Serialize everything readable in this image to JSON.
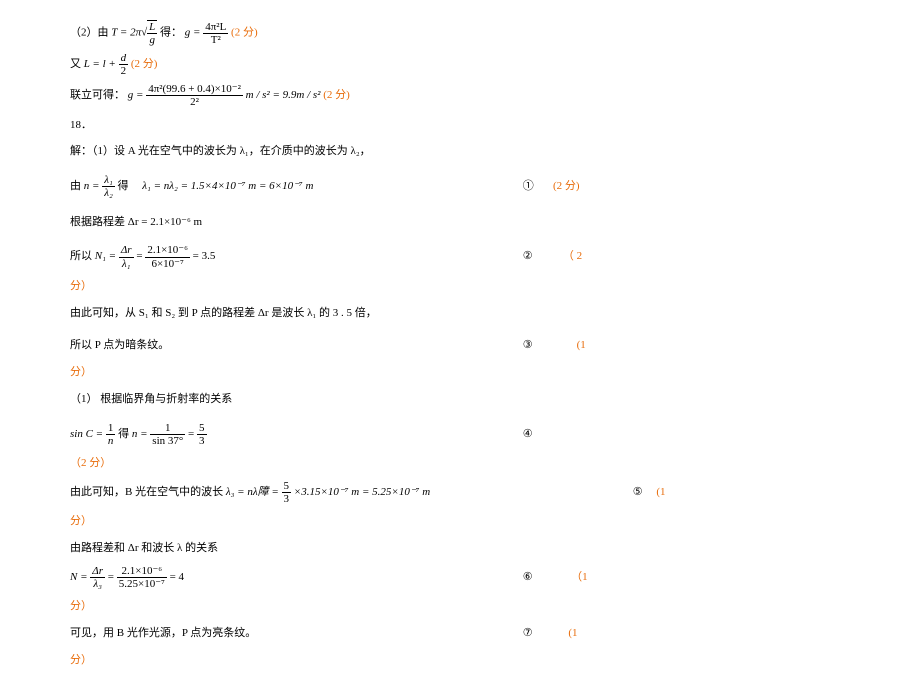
{
  "q2": {
    "intro": "（2）由",
    "eqT": "T = 2π",
    "sqrt_L": "L",
    "sqrt_g": "g",
    "deriv": "得：",
    "g_eq": "g =",
    "g_num": "4π²L",
    "g_den": "T²",
    "score1": "(2 分)",
    "also": "又",
    "L_eq": "L = l +",
    "d_num": "d",
    "d_den": "2",
    "score2": "(2 分)",
    "joint": "联立可得：",
    "g2_eq": "g =",
    "g2_num": "4π²(99.6 + 0.4)×10⁻²",
    "g2_den": "2²",
    "g2_unit1": "m / s² = 9.9m / s²",
    "score3": "(2 分)"
  },
  "q18": {
    "num": "18．",
    "sol": "解：（1）设 A 光在空气中的波长为 λ₁，在介质中的波长为 λ₂，",
    "by_n1": "由",
    "n_eq": "n =",
    "n_num": "λ₁",
    "n_den": "λ₂",
    "deriv": "得",
    "lam1": "λ₁ = nλ₂ = 1.5×4×10⁻⁷ m = 6×10⁻⁷ m",
    "circ1": "①",
    "score1": "(2 分)",
    "path": "根据路程差 Δr = 2.1×10⁻⁶ m",
    "so_N1": "所以",
    "N1_eq": "N₁ =",
    "N1_num1": "Δr",
    "N1_den1": "λ₁",
    "eq2": "=",
    "N1_num2": "2.1×10⁻⁶",
    "N1_den2": "6×10⁻⁷",
    "N1_res": "= 3.5",
    "circ2": "②",
    "score2": "（ 2",
    "fen1": "分）",
    "from_s": "由此可知，从 S₁ 和 S₂ 到 P 点的路程差 Δr 是波长 λ₁ 的 3 . 5 倍，",
    "dark": "所以 P 点为暗条纹。",
    "circ3": "③",
    "score3": "(1",
    "fen2": "分）",
    "part2": "（1） 根据临界角与折射率的关系",
    "sinC": "sin C =",
    "sinC_num": "1",
    "sinC_den": "n",
    "deriv2": "得",
    "n2": "n =",
    "n2_num": "1",
    "n2_den": "sin 37°",
    "eq3": "=",
    "frac53_num": "5",
    "frac53_den": "3",
    "circ4": "④",
    "score4": "（2 分）",
    "from_b": "由此可知，B 光在空气中的波长",
    "lam3": "λ₃ = nλ障 =",
    "lam3_num": "5",
    "lam3_den": "3",
    "lam3_tail": "×3.15×10⁻⁷ m = 5.25×10⁻⁷ m",
    "circ5": "⑤",
    "score5": "(1",
    "fen3": "分）",
    "bypath": "由路程差和 Δr 和波长 λ 的关系",
    "N_eq": "N =",
    "N_num1": "Δr",
    "N_den1": "λ₃",
    "N_num2": "2.1×10⁻⁶",
    "N_den2": "5.25×10⁻⁷",
    "N_res": "= 4",
    "circ6": "⑥",
    "score6": "（1",
    "fen4": "分）",
    "bright": "可见，用 B 光作光源，P 点为亮条纹。",
    "circ7": "⑦",
    "score7": "(1",
    "fen5": "分）"
  }
}
